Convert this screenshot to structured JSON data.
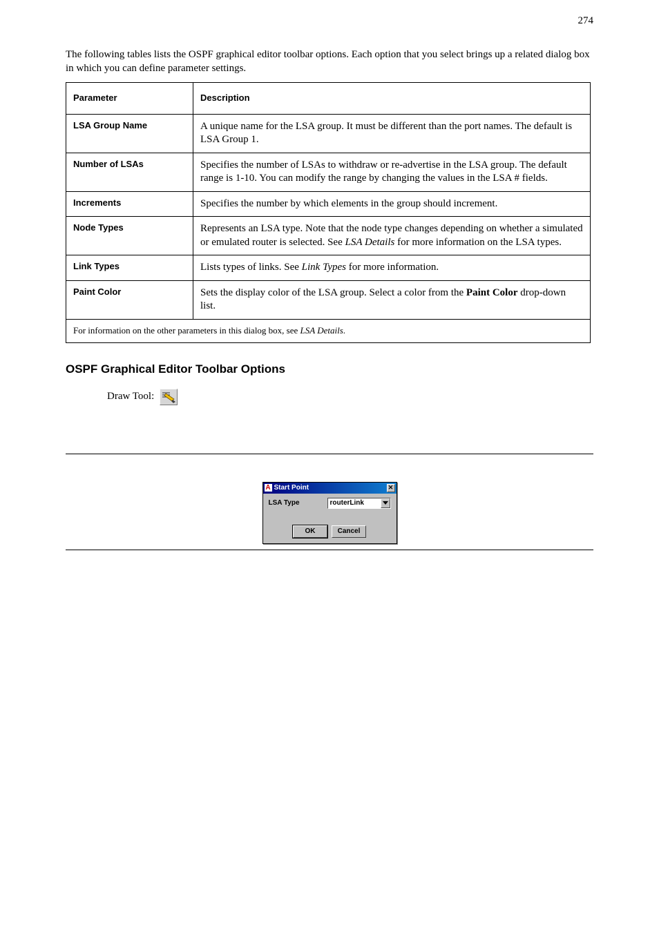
{
  "page_number": "274",
  "paragraphs": {
    "intro": "The following tables lists the OSPF graphical editor toolbar options. Each option that you select brings up a related dialog box in which you can define parameter settings."
  },
  "table": {
    "header": {
      "param": "Parameter",
      "desc": "Description"
    },
    "rows": [
      {
        "param": "LSA Group Name",
        "desc": "A unique name for the LSA group. It must be different than the port names. The default is LSA Group 1."
      },
      {
        "param": "Number of LSAs",
        "desc": "Specifies the number of LSAs to withdraw or re-advertise in the LSA group. The default range is 1-10. You can modify the range by changing the values in the LSA # fields."
      },
      {
        "param": "Increments",
        "desc": "Specifies the number by which elements in the group should increment."
      },
      {
        "param": "Node Types",
        "desc_html": "Represents an LSA type. Note that the node type changes depending on whether a simulated or emulated router is selected. See <span class=\"italic-inline\">LSA Details</span> for more information on the LSA types."
      },
      {
        "param": "Link Types",
        "desc_html": "Lists types of links. See <span class=\"italic-inline\">Link Types</span> for more information."
      },
      {
        "param": "Paint Color",
        "desc_html": "Sets the display color of the LSA group. Select a color from the <span class=\"bold-inline\">Paint Color</span> drop-down list."
      }
    ],
    "fullrow_html": "For information on the other parameters in this dialog box, see <span class=\"italic-inline\">LSA Details</span>."
  },
  "section_heading": "OSPF Graphical Editor Toolbar Options",
  "drawtool_label": "Draw Tool:",
  "dialog": {
    "title": "Start Point",
    "field_label": "LSA Type",
    "combo_value": "routerLink",
    "ok_label": "OK",
    "cancel_label": "Cancel"
  }
}
